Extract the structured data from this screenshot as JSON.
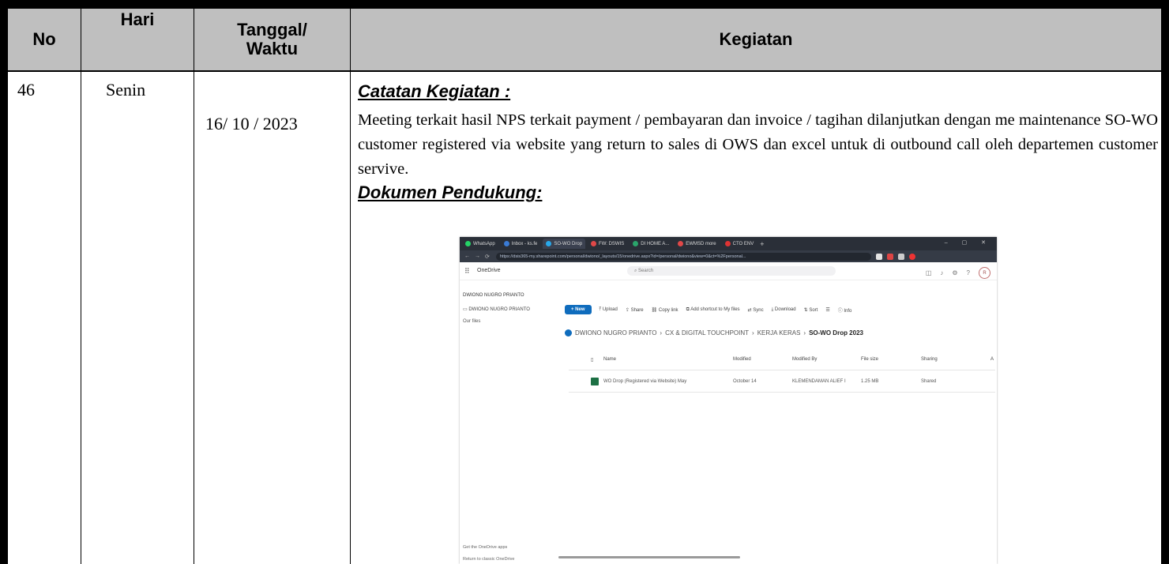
{
  "table": {
    "headers": {
      "no": "No",
      "hari": "Hari",
      "tanggal": "Tanggal/\nWaktu",
      "kegiatan": "Kegiatan"
    },
    "row": {
      "no": "46",
      "hari": "Senin",
      "tanggal": "16/ 10 / 2023",
      "catatan_title": "Catatan Kegiatan :",
      "catatan_text": "Meeting terkait hasil NPS terkait payment / pembayaran dan invoice / tagihan dilanjutkan dengan me maintenance SO-WO customer registered via website yang return to sales di OWS dan excel untuk di outbound call oleh departemen customer servive.",
      "dokumen_title": "Dokumen Pendukung:"
    }
  },
  "screenshot": {
    "tabs": [
      "WhatsApp",
      "Inbox - ks.fe",
      "SO-WO Drop",
      "FW: DSWIS",
      "DI HOME A...",
      "EWMSD more",
      "CTO ENV"
    ],
    "url": "https://dsis365-my.sharepoint.com/personal/dwiono/_layouts/15/onedrive.aspx?id=/personal/dwiono&view=0&ct=%2Fpersonal...",
    "app_name": "OneDrive",
    "search_placeholder": "Search",
    "avatar_initial": "R",
    "sidebar": {
      "user": "DWIONO NUGRO PRIANTO",
      "folder": "DWIONO NUGRO PRIANTO",
      "our_files": "Our files",
      "get_apps": "Get the OneDrive apps",
      "classic": "Return to classic OneDrive"
    },
    "commands": {
      "new": "+ New",
      "upload": "Upload",
      "share": "Share",
      "copy_link": "Copy link",
      "add_shortcut": "Add shortcut to My files",
      "sync": "Sync",
      "download": "Download",
      "sort": "Sort",
      "view": "",
      "info": "Info"
    },
    "breadcrumb": [
      "DWIONO NUGRO PRIANTO",
      "CX & DIGITAL TOUCHPOINT",
      "KERJA KERAS"
    ],
    "breadcrumb_current": "SO-WO Drop 2023",
    "columns": [
      "Name",
      "Modified",
      "Modified By",
      "File size",
      "Sharing",
      "A"
    ],
    "file": {
      "name": "WO Drop (Registered via Website) May",
      "modified": "October 14",
      "modified_by": "KLEMENDAMAN ALIEF I",
      "size": "1.25 MB",
      "sharing": "Shared"
    },
    "colors": {
      "tabbar": "#2a2f38",
      "brand": "#0f6cbd",
      "excel": "#1d7044"
    }
  }
}
